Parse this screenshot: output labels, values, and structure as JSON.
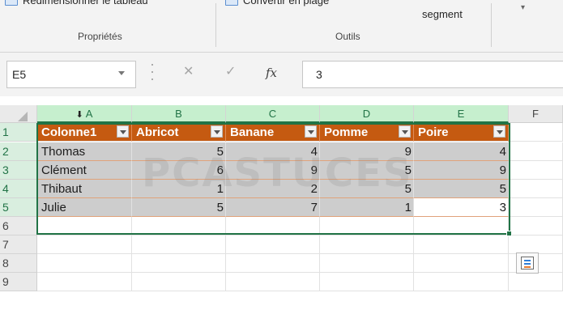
{
  "ribbon": {
    "table_resize_label": "Redimensionner le tableau",
    "convert_range_label": "Convertir en plage",
    "slicer_label": "segment",
    "group_properties": "Propriétés",
    "group_tools": "Outils"
  },
  "formula_bar": {
    "name_box": "E5",
    "fx_label": "fx",
    "formula_value": "3"
  },
  "sheet": {
    "columns": [
      "A",
      "B",
      "C",
      "D",
      "E",
      "F"
    ],
    "rows": [
      "1",
      "2",
      "3",
      "4",
      "5",
      "6",
      "7",
      "8",
      "9"
    ],
    "table": {
      "headers": [
        "Colonne1",
        "Abricot",
        "Banane",
        "Pomme",
        "Poire"
      ],
      "data": [
        [
          "Thomas",
          "5",
          "4",
          "9",
          "4"
        ],
        [
          "Clément",
          "6",
          "9",
          "5",
          "9"
        ],
        [
          "Thibaut",
          "1",
          "2",
          "5",
          "5"
        ],
        [
          "Julie",
          "5",
          "7",
          "1",
          "3"
        ]
      ]
    },
    "watermark": "PCASTUCES"
  },
  "colors": {
    "table_header": "#c55a11",
    "selection": "#217346",
    "band_border": "#e0a27a"
  },
  "icons": {
    "cancel": "close-icon",
    "enter": "check-icon",
    "quick_analysis": "quick-analysis-icon"
  }
}
